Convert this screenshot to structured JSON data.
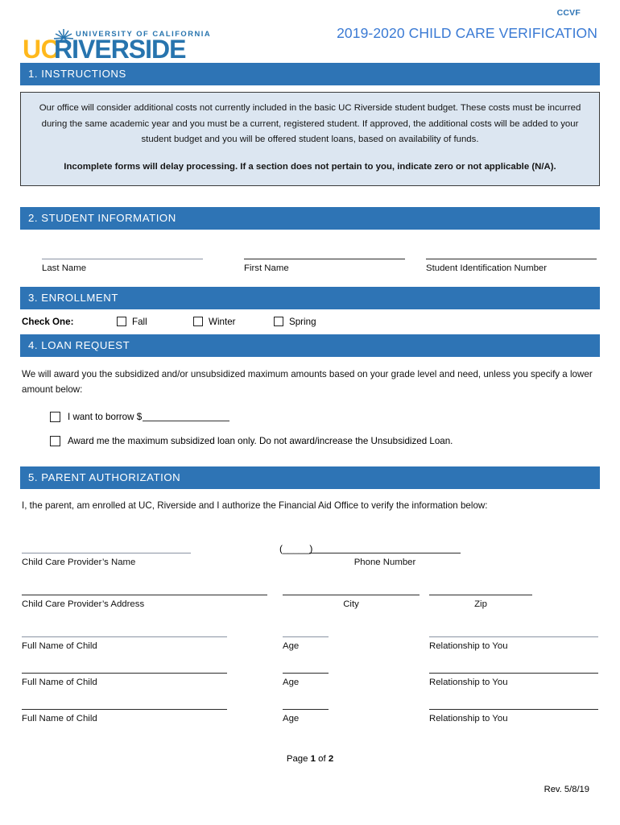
{
  "header": {
    "form_code": "CCVF",
    "doc_title": "2019-2020 CHILD CARE VERIFICATION",
    "logo": {
      "uc_text": "UC",
      "riverside_text": "RIVERSIDE",
      "tagline": "UNIVERSITY OF CALIFORNIA",
      "gold": "#FFB81C",
      "blue": "#2774AE"
    }
  },
  "colors": {
    "section_bar": "#2E74B5",
    "instruction_box_bg": "#DCE6F1",
    "title_blue": "#3a7ad4"
  },
  "sections": {
    "instructions": {
      "bar_label": "1. INSTRUCTIONS",
      "paragraph": "Our office will consider additional costs not currently included in the basic UC Riverside student budget.  These costs must be incurred during the same academic year and you must be a current, registered student.  If approved, the additional costs will be added to your student budget and you will be offered student loans, based on availability of funds.",
      "bold_note": "Incomplete forms will delay processing.  If a section does not pertain to you, indicate zero or not applicable (N/A)."
    },
    "student_information": {
      "bar_label": "2. STUDENT INFORMATION",
      "fields": [
        {
          "label": "Last Name"
        },
        {
          "label": "First Name"
        },
        {
          "label": "Student Identification Number"
        }
      ]
    },
    "enrollment": {
      "bar_label": "3. ENROLLMENT",
      "check_one_label": "Check One:",
      "options": [
        {
          "label": "Fall"
        },
        {
          "label": "Winter"
        },
        {
          "label": "Spring"
        }
      ]
    },
    "loan_request": {
      "bar_label": "4. LOAN REQUEST",
      "intro": "We will award you the subsidized and/or unsubsidized maximum amounts based on your grade level and need, unless you specify a lower amount below:",
      "option_borrow_prefix": "I want to borrow $",
      "option_max_subsidized": "Award me the maximum subsidized loan only.  Do not award/increase the Unsubsidized Loan."
    },
    "parent_authorization": {
      "bar_label": "5. PARENT AUTHORIZATION",
      "statement": "I, the parent, am enrolled at UC, Riverside and I authorize the Financial Aid Office to verify the information below:",
      "provider_name_label": "Child Care Provider’s Name",
      "phone_label": "Phone Number",
      "phone_area_prefix": "(_____)",
      "provider_address_label": "Child Care Provider’s Address",
      "city_label": "City",
      "zip_label": "Zip",
      "children": [
        {
          "name_label": "Full Name of Child",
          "age_label": "Age",
          "relationship_label": "Relationship to You"
        },
        {
          "name_label": "Full Name of Child",
          "age_label": "Age",
          "relationship_label": "Relationship to You"
        },
        {
          "name_label": "Full Name of Child",
          "age_label": "Age",
          "relationship_label": "Relationship to You"
        }
      ]
    }
  },
  "footer": {
    "page_prefix": "Page ",
    "page_current": "1",
    "page_middle": " of ",
    "page_total": "2",
    "revision": "Rev. 5/8/19"
  }
}
